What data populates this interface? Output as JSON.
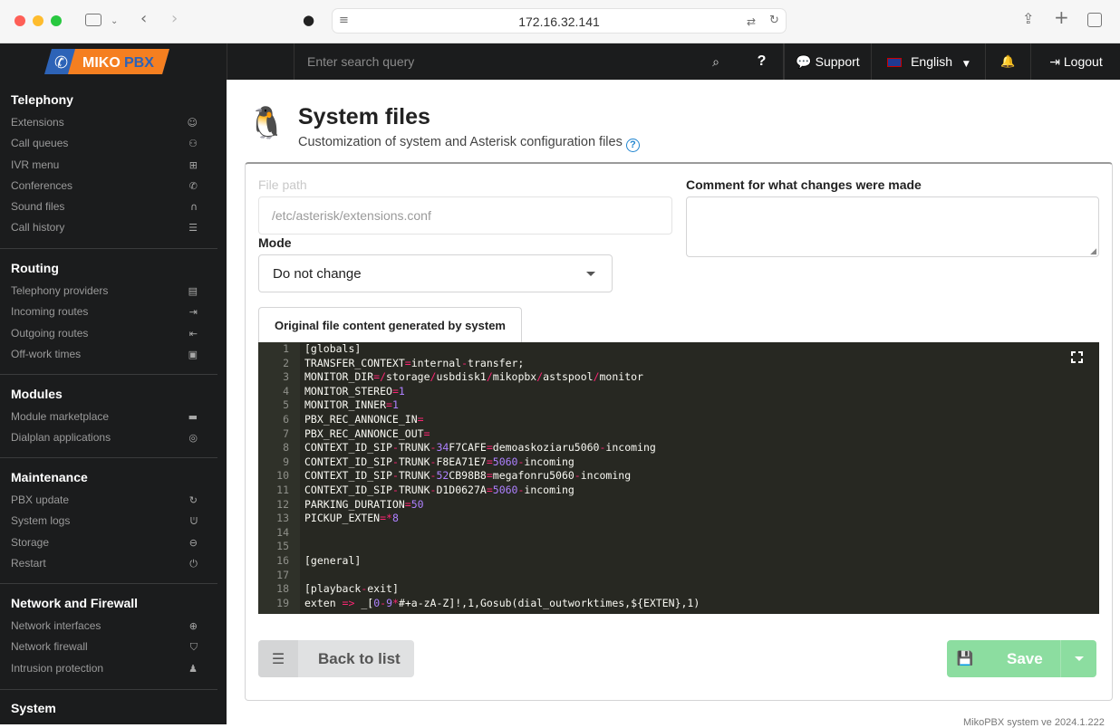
{
  "browser": {
    "url": "172.16.32.141",
    "colors": {
      "close": "#fe5f57",
      "minimize": "#febc2e",
      "maximize": "#28c840"
    }
  },
  "logo": {
    "text_a": "MIKO",
    "text_b": "PBX"
  },
  "topbar": {
    "search_placeholder": "Enter search query",
    "help_label": "?",
    "support_label": "Support",
    "language_label": "English",
    "logout_label": "Logout"
  },
  "sidebar": {
    "sections": [
      {
        "title": "Telephony",
        "items": [
          {
            "label": "Extensions",
            "icon": "user-icon"
          },
          {
            "label": "Call queues",
            "icon": "users-icon"
          },
          {
            "label": "IVR menu",
            "icon": "sitemap-icon"
          },
          {
            "label": "Conferences",
            "icon": "phone-volume-icon"
          },
          {
            "label": "Sound files",
            "icon": "headphones-icon"
          },
          {
            "label": "Call history",
            "icon": "list-icon"
          }
        ]
      },
      {
        "title": "Routing",
        "items": [
          {
            "label": "Telephony providers",
            "icon": "server-icon"
          },
          {
            "label": "Incoming routes",
            "icon": "sign-in-icon"
          },
          {
            "label": "Outgoing routes",
            "icon": "sign-out-icon"
          },
          {
            "label": "Off-work times",
            "icon": "calendar-icon"
          }
        ]
      },
      {
        "title": "Modules",
        "items": [
          {
            "label": "Module marketplace",
            "icon": "store-icon"
          },
          {
            "label": "Dialplan applications",
            "icon": "php-icon"
          }
        ]
      },
      {
        "title": "Maintenance",
        "items": [
          {
            "label": "PBX update",
            "icon": "sync-icon"
          },
          {
            "label": "System logs",
            "icon": "stethoscope-icon"
          },
          {
            "label": "Storage",
            "icon": "hdd-icon"
          },
          {
            "label": "Restart",
            "icon": "power-icon"
          }
        ]
      },
      {
        "title": "Network and Firewall",
        "items": [
          {
            "label": "Network interfaces",
            "icon": "globe-icon"
          },
          {
            "label": "Network firewall",
            "icon": "shield-icon"
          },
          {
            "label": "Intrusion protection",
            "icon": "user-secret-icon"
          }
        ]
      },
      {
        "title": "System",
        "items": []
      }
    ]
  },
  "page": {
    "title": "System files",
    "subtitle": "Customization of system and Asterisk configuration files",
    "file_path_label": "File path",
    "file_path_value": "/etc/asterisk/extensions.conf",
    "comment_label": "Comment for what changes were made",
    "comment_value": "",
    "mode_label": "Mode",
    "mode_value": "Do not change",
    "tab_label": "Original file content generated by system",
    "back_label": "Back to list",
    "save_label": "Save",
    "footer": "MikoPBX system ve 2024.1.222"
  },
  "editor": {
    "lines": [
      [
        [
          "t",
          "[globals]"
        ]
      ],
      [
        [
          "t",
          "TRANSFER_CONTEXT"
        ],
        [
          "o",
          "="
        ],
        [
          "t",
          "internal"
        ],
        [
          "o",
          "-"
        ],
        [
          "t",
          "transfer;"
        ]
      ],
      [
        [
          "t",
          "MONITOR_DIR"
        ],
        [
          "o",
          "=/"
        ],
        [
          "t",
          "storage"
        ],
        [
          "o",
          "/"
        ],
        [
          "t",
          "usbdisk1"
        ],
        [
          "o",
          "/"
        ],
        [
          "t",
          "mikopbx"
        ],
        [
          "o",
          "/"
        ],
        [
          "t",
          "astspool"
        ],
        [
          "o",
          "/"
        ],
        [
          "t",
          "monitor"
        ]
      ],
      [
        [
          "t",
          "MONITOR_STEREO"
        ],
        [
          "o",
          "="
        ],
        [
          "n",
          "1"
        ]
      ],
      [
        [
          "t",
          "MONITOR_INNER"
        ],
        [
          "o",
          "="
        ],
        [
          "n",
          "1"
        ]
      ],
      [
        [
          "t",
          "PBX_REC_ANNONCE_IN"
        ],
        [
          "o",
          "="
        ]
      ],
      [
        [
          "t",
          "PBX_REC_ANNONCE_OUT"
        ],
        [
          "o",
          "="
        ]
      ],
      [
        [
          "t",
          "CONTEXT_ID_SIP"
        ],
        [
          "o",
          "-"
        ],
        [
          "t",
          "TRUNK"
        ],
        [
          "o",
          "-"
        ],
        [
          "n",
          "34"
        ],
        [
          "t",
          "F7CAFE"
        ],
        [
          "o",
          "="
        ],
        [
          "t",
          "demoaskoziaru5060"
        ],
        [
          "o",
          "-"
        ],
        [
          "t",
          "incoming"
        ]
      ],
      [
        [
          "t",
          "CONTEXT_ID_SIP"
        ],
        [
          "o",
          "-"
        ],
        [
          "t",
          "TRUNK"
        ],
        [
          "o",
          "-"
        ],
        [
          "t",
          "F8EA71E7"
        ],
        [
          "o",
          "="
        ],
        [
          "n",
          "5060"
        ],
        [
          "o",
          "-"
        ],
        [
          "t",
          "incoming"
        ]
      ],
      [
        [
          "t",
          "CONTEXT_ID_SIP"
        ],
        [
          "o",
          "-"
        ],
        [
          "t",
          "TRUNK"
        ],
        [
          "o",
          "-"
        ],
        [
          "n",
          "52"
        ],
        [
          "t",
          "CB98B8"
        ],
        [
          "o",
          "="
        ],
        [
          "t",
          "megafonru5060"
        ],
        [
          "o",
          "-"
        ],
        [
          "t",
          "incoming"
        ]
      ],
      [
        [
          "t",
          "CONTEXT_ID_SIP"
        ],
        [
          "o",
          "-"
        ],
        [
          "t",
          "TRUNK"
        ],
        [
          "o",
          "-"
        ],
        [
          "t",
          "D1D0627A"
        ],
        [
          "o",
          "="
        ],
        [
          "n",
          "5060"
        ],
        [
          "o",
          "-"
        ],
        [
          "t",
          "incoming"
        ]
      ],
      [
        [
          "t",
          "PARKING_DURATION"
        ],
        [
          "o",
          "="
        ],
        [
          "n",
          "50"
        ]
      ],
      [
        [
          "t",
          "PICKUP_EXTEN"
        ],
        [
          "o",
          "=*"
        ],
        [
          "n",
          "8"
        ]
      ],
      [
        [
          "t",
          ""
        ]
      ],
      [
        [
          "t",
          ""
        ]
      ],
      [
        [
          "t",
          "[general]"
        ]
      ],
      [
        [
          "t",
          ""
        ]
      ],
      [
        [
          "t",
          "[playback"
        ],
        [
          "o",
          "-"
        ],
        [
          "t",
          "exit]"
        ]
      ],
      [
        [
          "t",
          "exten "
        ],
        [
          "o",
          "=>"
        ],
        [
          "t",
          " _["
        ],
        [
          "n",
          "0"
        ],
        [
          "o",
          "-"
        ],
        [
          "n",
          "9"
        ],
        [
          "o",
          "*"
        ],
        [
          "t",
          "#+a-zA-Z]!,1,Gosub(dial_outworktimes,${EXTEN},1)"
        ]
      ]
    ]
  }
}
